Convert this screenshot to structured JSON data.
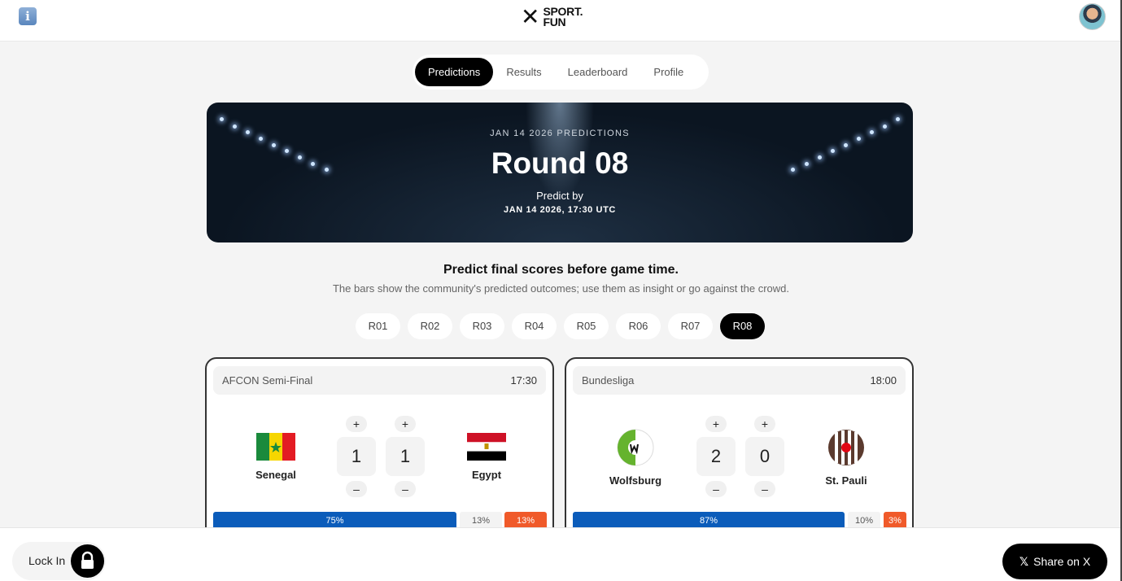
{
  "header": {
    "info_icon": "info-icon",
    "info_glyph": "i",
    "logo_mark": "✕",
    "logo_line1": "SPORT.",
    "logo_line2": "FUN"
  },
  "tabs": [
    {
      "label": "Predictions",
      "active": true
    },
    {
      "label": "Results",
      "active": false
    },
    {
      "label": "Leaderboard",
      "active": false
    },
    {
      "label": "Profile",
      "active": false
    }
  ],
  "hero": {
    "subtitle": "JAN 14 2026 PREDICTIONS",
    "title": "Round 08",
    "predict_by": "Predict by",
    "deadline": "JAN 14 2026, 17:30 UTC"
  },
  "intro": {
    "heading": "Predict final scores before game time.",
    "subheading": "The bars show the community's predicted outcomes; use them as insight or go against the crowd."
  },
  "rounds": [
    "R01",
    "R02",
    "R03",
    "R04",
    "R05",
    "R06",
    "R07",
    "R08"
  ],
  "active_round": "R08",
  "matches": [
    {
      "competition": "AFCON Semi-Final",
      "time": "17:30",
      "home": {
        "name": "Senegal",
        "score": "1"
      },
      "away": {
        "name": "Egypt",
        "score": "1"
      },
      "plus": "+",
      "minus": "–",
      "community": {
        "home": "75%",
        "draw": "13%",
        "away": "13%",
        "home_pct": 75,
        "draw_pct": 13,
        "away_pct": 13
      }
    },
    {
      "competition": "Bundesliga",
      "time": "18:00",
      "home": {
        "name": "Wolfsburg",
        "score": "2"
      },
      "away": {
        "name": "St. Pauli",
        "score": "0"
      },
      "plus": "+",
      "minus": "–",
      "community": {
        "home": "87%",
        "draw": "10%",
        "away": "3%",
        "home_pct": 87,
        "draw_pct": 10,
        "away_pct": 3
      }
    }
  ],
  "footer": {
    "lock_label": "Lock In",
    "share_label": "Share on X",
    "share_glyph": "𝕏"
  },
  "colors": {
    "home_bar": "#0b5cba",
    "away_bar": "#f05a2a",
    "active": "#000000"
  }
}
